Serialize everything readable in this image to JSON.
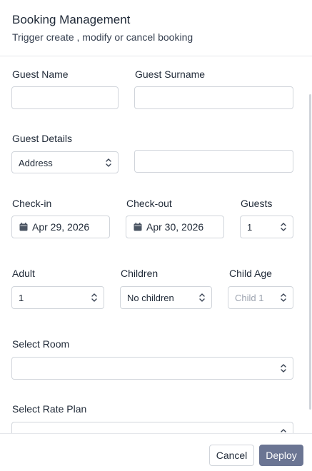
{
  "header": {
    "title": "Booking Management",
    "subtitle": "Trigger create , modify or cancel booking"
  },
  "form": {
    "guest_name": {
      "label": "Guest Name",
      "value": ""
    },
    "guest_surname": {
      "label": "Guest Surname",
      "value": ""
    },
    "guest_details": {
      "label": "Guest Details",
      "selected": "Address",
      "value": ""
    },
    "check_in": {
      "label": "Check-in",
      "value": "Apr 29, 2026"
    },
    "check_out": {
      "label": "Check-out",
      "value": "Apr 30, 2026"
    },
    "guests": {
      "label": "Guests",
      "selected": "1"
    },
    "adult": {
      "label": "Adult",
      "selected": "1"
    },
    "children": {
      "label": "Children",
      "selected": "No children"
    },
    "child_age": {
      "label": "Child Age",
      "placeholder": "Child 1"
    },
    "select_room": {
      "label": "Select Room",
      "selected": ""
    },
    "select_rate_plan": {
      "label": "Select Rate Plan",
      "selected": ""
    }
  },
  "footer": {
    "cancel_label": "Cancel",
    "deploy_label": "Deploy"
  },
  "colors": {
    "deploy_button": "#6b7593",
    "border": "#d1d5db"
  }
}
